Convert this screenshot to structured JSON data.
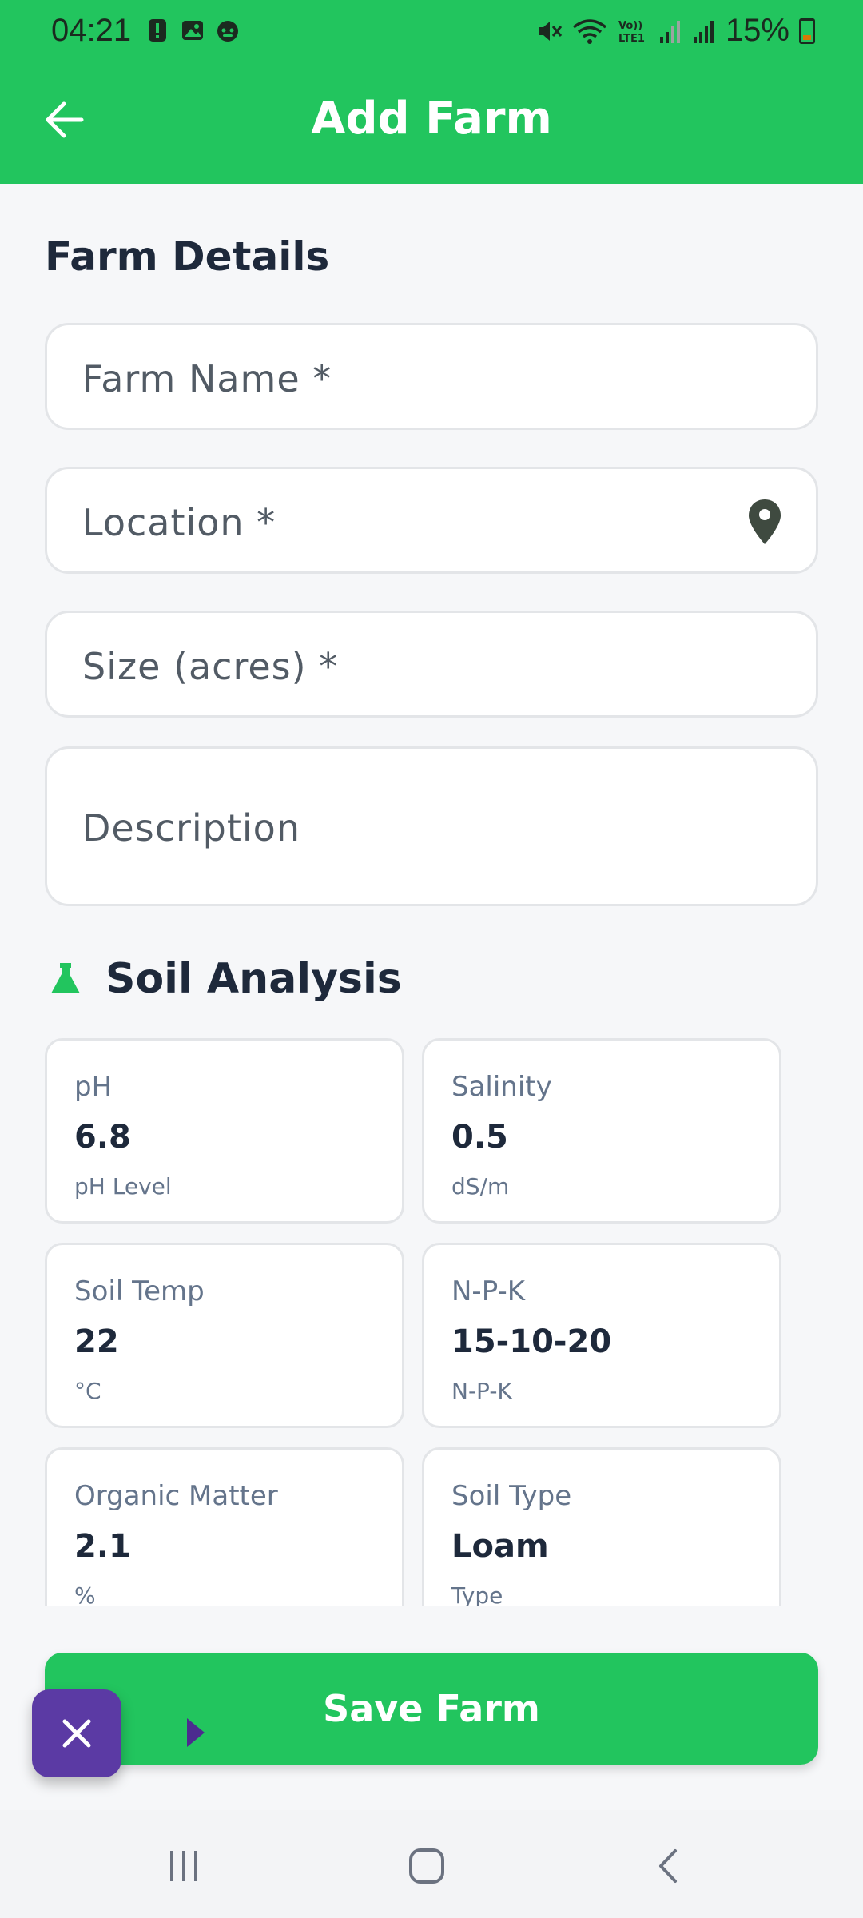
{
  "status_bar": {
    "time": "04:21",
    "left_icons": [
      "alert-icon",
      "image-icon",
      "face-icon"
    ],
    "right_icons": [
      "mute-icon",
      "wifi-icon",
      "volte-icon",
      "signal-icon",
      "signal-icon"
    ],
    "battery": "15%"
  },
  "header": {
    "title": "Add Farm",
    "back_icon": "back-arrow-icon"
  },
  "farm_details": {
    "title": "Farm Details",
    "fields": {
      "farm_name": {
        "placeholder": "Farm Name *"
      },
      "location": {
        "placeholder": "Location *",
        "icon": "location-pin-icon"
      },
      "size": {
        "placeholder": "Size (acres) *"
      },
      "description": {
        "placeholder": "Description"
      }
    }
  },
  "soil_analysis": {
    "title": "Soil Analysis",
    "icon": "flask-icon",
    "cards": [
      {
        "label": "pH",
        "value": "6.8",
        "unit": "pH Level"
      },
      {
        "label": "Salinity",
        "value": "0.5",
        "unit": "dS/m"
      },
      {
        "label": "Soil Temp",
        "value": "22",
        "unit": "°C"
      },
      {
        "label": "N-P-K",
        "value": "15-10-20",
        "unit": "N-P-K"
      },
      {
        "label": "Organic Matter",
        "value": "2.1",
        "unit": "%"
      },
      {
        "label": "Soil Type",
        "value": "Loam",
        "unit": "Type"
      }
    ]
  },
  "actions": {
    "save_label": "Save Farm"
  },
  "colors": {
    "primary": "#22c55e",
    "fab": "#5b3aa4",
    "text_dark": "#1e293b",
    "text_muted": "#64748b"
  }
}
